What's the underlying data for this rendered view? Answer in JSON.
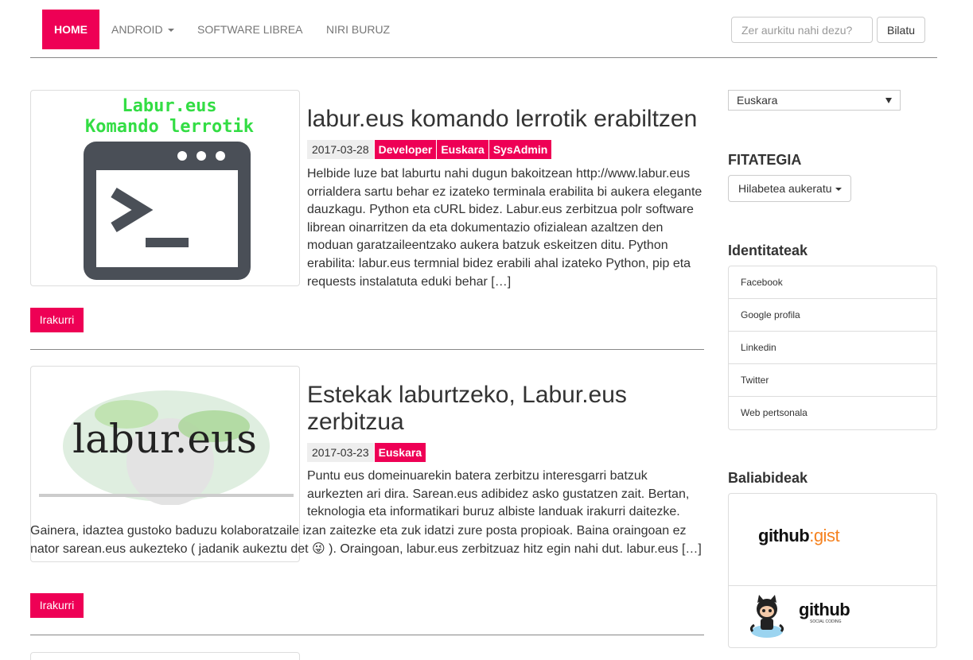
{
  "nav": {
    "home": "HOME",
    "android": "ANDROID",
    "software": "SOFTWARE LIBREA",
    "about": "NIRI BURUZ",
    "search_placeholder": "Zer aurkitu nahi dezu?",
    "search_button": "Bilatu"
  },
  "posts": [
    {
      "title": "labur.eus komando lerrotik erabiltzen",
      "date": "2017-03-28",
      "tags": [
        "Developer",
        "Euskara",
        "SysAdmin"
      ],
      "thumb_text_1": "Labur.eus",
      "thumb_text_2": "Komando lerrotik",
      "excerpt": "Helbide luze bat laburtu nahi dugun bakoitzean http://www.labur.eus orrialdera sartu behar ez izateko terminala erabilita bi aukera elegante dauzkagu. Python eta cURL bidez. Labur.eus zerbitzua polr software librean oinarritzen da eta dokumentazio ofizialean azaltzen den moduan garatzaileentzako aukera batzuk eskeitzen ditu. Python erabilita: labur.eus termnial bidez erabili ahal izateko Python, pip eta requests instalatuta eduki behar […]",
      "read_more": "Irakurri"
    },
    {
      "title": "Estekak laburtzeko, Labur.eus zerbitzua",
      "date": "2017-03-23",
      "tags": [
        "Euskara"
      ],
      "thumb_text_1": "labur.eus",
      "excerpt_narrow": "Puntu eus domeinuarekin batera zerbitzu interesgarri batzuk aurkezten ari dira. Sarean.eus adibidez asko gustatzen zait. Bertan, teknologia eta informatikari buruz albiste landuak irakurri daitezke.",
      "excerpt_wide": "Gainera, idaztea gustoko baduzu kolaboratzaile izan zaitezke eta zuk idatzi zure posta propioak. Baina oraingoan ez nator sarean.eus aukezteko ( jadanik aukeztu det 😜 ). Oraingoan, labur.eus zerbitzuaz hitz egin nahi dut. labur.eus […]",
      "read_more": "Irakurri"
    }
  ],
  "sidebar": {
    "language": "Euskara",
    "archive_title": "FITATEGIA",
    "archive_button": "Hilabetea aukeratu",
    "identities_title": "Identitateak",
    "identities": [
      "Facebook",
      "Google profila",
      "Linkedin",
      "Twitter",
      "Web pertsonala"
    ],
    "resources_title": "Baliabideak",
    "gist_logo": "github:gist",
    "github_logo": "github",
    "github_sub": "SOCIAL CODING"
  },
  "colors": {
    "accent": "#ee0055"
  }
}
